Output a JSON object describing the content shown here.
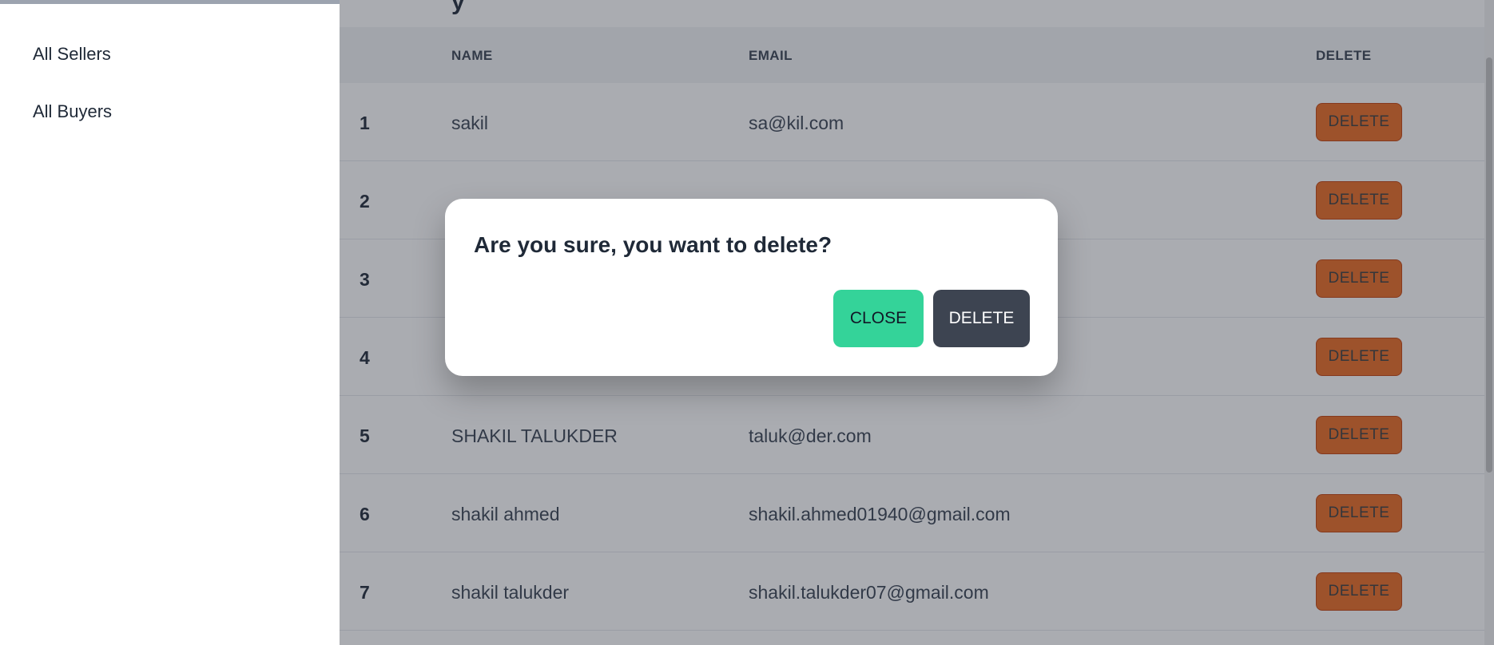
{
  "sidebar": {
    "items": [
      {
        "label": "All Sellers"
      },
      {
        "label": "All Buyers"
      }
    ]
  },
  "table": {
    "headers": {
      "index": "",
      "name": "NAME",
      "email": "EMAIL",
      "delete": "DELETE"
    },
    "rows": [
      {
        "index": "1",
        "name": "sakil",
        "email": "sa@kil.com",
        "action": "DELETE"
      },
      {
        "index": "2",
        "name": "",
        "email": "",
        "action": "DELETE"
      },
      {
        "index": "3",
        "name": "",
        "email": "",
        "action": "DELETE"
      },
      {
        "index": "4",
        "name": "",
        "email": "",
        "action": "DELETE"
      },
      {
        "index": "5",
        "name": "SHAKIL TALUKDER",
        "email": "taluk@der.com",
        "action": "DELETE"
      },
      {
        "index": "6",
        "name": "shakil ahmed",
        "email": "shakil.ahmed01940@gmail.com",
        "action": "DELETE"
      },
      {
        "index": "7",
        "name": "shakil talukder",
        "email": "shakil.talukder07@gmail.com",
        "action": "DELETE"
      }
    ]
  },
  "modal": {
    "title": "Are you sure, you want to delete?",
    "close_label": "CLOSE",
    "delete_label": "DELETE"
  },
  "colors": {
    "row_delete_button": "#ea6a21",
    "modal_close_button": "#34d399",
    "modal_delete_button": "#3d4451"
  }
}
